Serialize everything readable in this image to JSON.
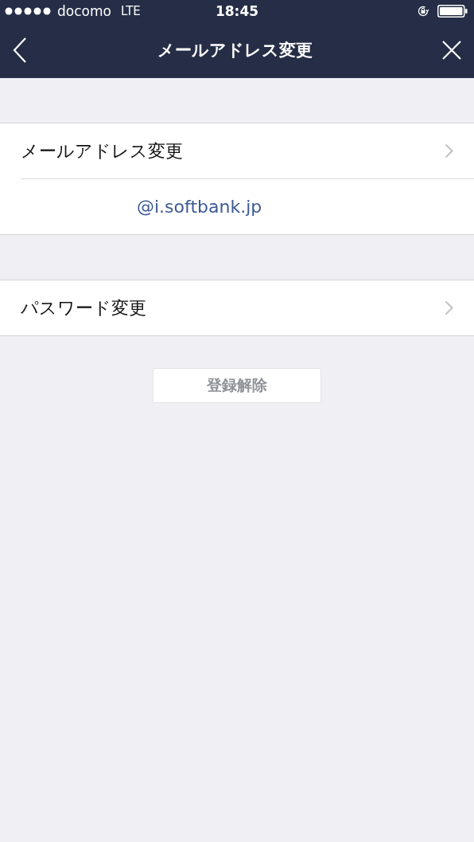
{
  "status_bar": {
    "carrier": "docomo",
    "network": "LTE",
    "time": "18:45"
  },
  "nav": {
    "title": "メールアドレス変更"
  },
  "sections": [
    {
      "rows": [
        {
          "kind": "link",
          "label": "メールアドレス変更"
        },
        {
          "kind": "value",
          "label": "@i.softbank.jp"
        }
      ]
    },
    {
      "rows": [
        {
          "kind": "link",
          "label": "パスワード変更"
        }
      ]
    }
  ],
  "unregister_button": "登録解除"
}
